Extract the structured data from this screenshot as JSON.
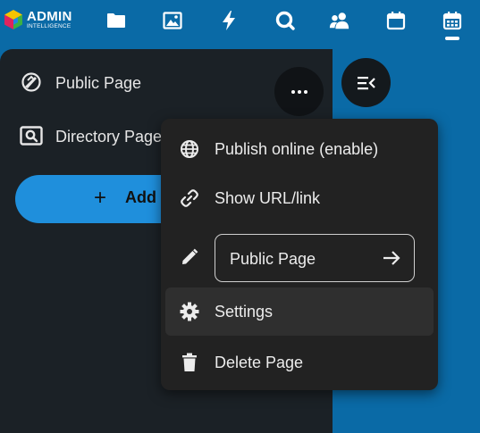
{
  "app": {
    "logo_title": "ADMIN",
    "logo_subtitle": "INTELLIGENCE"
  },
  "topnav": {
    "icons": [
      "folder-icon",
      "image-icon",
      "lightning-icon",
      "search-bubble-icon",
      "users-icon",
      "calendar-icon",
      "calendar-grid-icon"
    ],
    "active": "calendar-grid-icon"
  },
  "sidebar": {
    "items": [
      {
        "label": "Public Page",
        "icon": "globe-rocket-icon"
      },
      {
        "label": "Directory Page",
        "icon": "search-frame-icon"
      }
    ],
    "add_button_label": "Add"
  },
  "menu": {
    "publish_label": "Publish online (enable)",
    "show_url_label": "Show URL/link",
    "page_name_value": "Public Page",
    "settings_label": "Settings",
    "delete_label": "Delete Page"
  },
  "colors": {
    "background": "#0a6aa6",
    "sidebar": "#1b2126",
    "menu": "#222222",
    "accent": "#1f8fdc"
  }
}
